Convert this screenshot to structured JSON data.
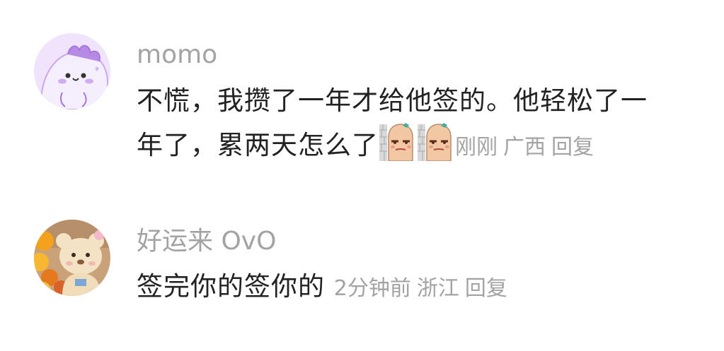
{
  "comments": [
    {
      "username": "momo",
      "text_line1": "不慌，我攒了一年才给他签的。他轻松了一",
      "text_line2": "年了，累两天怎么了",
      "stickers": [
        "smug-sausage-sticker",
        "smug-sausage-sticker"
      ],
      "time": "刚刚",
      "location": "广西",
      "reply_label": "回复",
      "avatar": "purple-dinosaur-avatar"
    },
    {
      "username": "好运来 OvO",
      "text": "签完你的签你的",
      "time": "2分钟前",
      "location": "浙江",
      "reply_label": "回复",
      "avatar": "plush-toy-flowers-avatar"
    }
  ],
  "colors": {
    "text": "#222222",
    "meta": "#a3a3a3",
    "background": "#ffffff",
    "avatar1_bg": "#e9dcf7",
    "avatar2_bg": "#e48a3c"
  }
}
